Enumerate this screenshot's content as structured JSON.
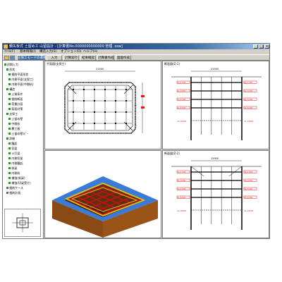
{
  "window": {
    "title": "鋼矢板式 土留め工 山留設計 - [計算書No.0000000000000 管理 .ssw]"
  },
  "menu": {
    "items": [
      "ﾌｧｲﾙ(F)",
      "基本情報(I)",
      "構造入力(S)",
      "オプション(O)",
      "ヘルプ(H)"
    ]
  },
  "toolbar": {
    "mode_select_label": "支保工モードの選択",
    "tabs": [
      "入力",
      "計算実行",
      "結果確認",
      "計算書作成",
      "図面作成"
    ]
  },
  "tree": {
    "items": [
      {
        "label": "初期入力"
      },
      {
        "label": "形状"
      },
      {
        "label": "掘削平面形状"
      },
      {
        "label": "内側平面(支保工)"
      },
      {
        "label": "内側平面(中間杭)"
      },
      {
        "label": "構造"
      },
      {
        "label": "土質条件"
      },
      {
        "label": "掘削断面"
      },
      {
        "label": "荷重計画"
      },
      {
        "label": "背面対策"
      },
      {
        "label": "支保工"
      },
      {
        "label": "土留め壁"
      },
      {
        "label": "中間杭"
      },
      {
        "label": "覆工板"
      },
      {
        "label": "土留め壁ｺﾋﾟｰ"
      },
      {
        "label": "詳細"
      },
      {
        "label": "腹起"
      },
      {
        "label": "切梁"
      },
      {
        "label": "火打梁"
      },
      {
        "label": "内側切梁"
      },
      {
        "label": "内側腹起"
      },
      {
        "label": "斜梁"
      },
      {
        "label": "内側杭"
      },
      {
        "label": "補強(斜梁)"
      },
      {
        "label": "補強(切梁受け)"
      },
      {
        "label": "掘削ケース"
      },
      {
        "label": "掘削計画"
      }
    ]
  },
  "panels": {
    "plan": {
      "title": "平面図(支保工)"
    },
    "section1": {
      "title": "断面図(Z-1)"
    },
    "view3d": {
      "title": ""
    },
    "section2": {
      "title": "断面図(Z-2)"
    }
  },
  "drawing": {
    "plan_dim": "21500",
    "section1_dim": "21500",
    "section2_dim": "15900",
    "levels": [
      "GL-1.550",
      "GL-3.050",
      "GL-5.000",
      "GL-6.900",
      "GL-10000"
    ]
  },
  "colors": {
    "titlebar": "#0a246a",
    "accent_red": "#e01818",
    "ground": "#9a5418",
    "ground_top": "#3a7ad8",
    "support_red": "#d01010",
    "support_yellow": "#e2c020",
    "node_green": "#2f8f2f"
  }
}
